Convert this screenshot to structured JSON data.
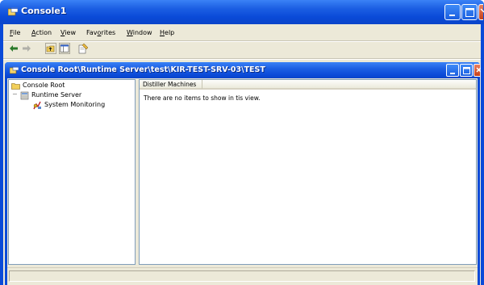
{
  "window": {
    "title": "Console1",
    "accent": "#0a4ad8"
  },
  "menubar": {
    "items": [
      {
        "underline": "F",
        "rest": "ile"
      },
      {
        "underline": "A",
        "rest": "ction"
      },
      {
        "underline": "V",
        "rest": "iew"
      },
      {
        "prefix": "Fav",
        "underline": "o",
        "rest": "rites"
      },
      {
        "underline": "W",
        "rest": "indow"
      },
      {
        "underline": "H",
        "rest": "elp"
      }
    ]
  },
  "toolbar": {
    "buttons": [
      "back-icon",
      "forward-icon",
      "up-folder-icon",
      "show-hide-tree-icon",
      "properties-icon"
    ]
  },
  "child_window": {
    "title": "Console Root\\Runtime Server\\test\\KIR-TEST-SRV-03\\TEST"
  },
  "tree": {
    "items": [
      {
        "label": "Console Root",
        "icon": "folder-icon"
      },
      {
        "label": "Runtime Server",
        "icon": "server-icon",
        "expander": "−"
      },
      {
        "label": "System Monitoring",
        "icon": "monitoring-icon"
      }
    ]
  },
  "list": {
    "column_header": "Distiller Machines",
    "empty_message": "There are no items to show in tis view."
  }
}
